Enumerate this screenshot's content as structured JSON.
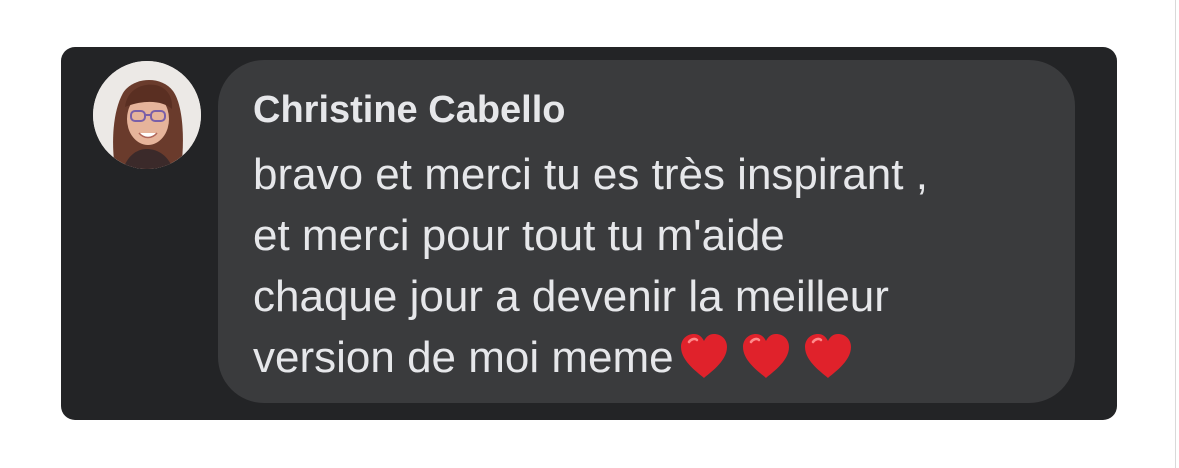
{
  "comment": {
    "author": "Christine Cabello",
    "message_lines": [
      "bravo et merci tu es très inspirant ,",
      "et merci pour tout tu m'aide",
      "chaque jour a devenir la meilleur",
      "version de moi meme"
    ],
    "emoji": [
      "red-heart",
      "red-heart",
      "red-heart"
    ]
  },
  "colors": {
    "card_background": "#232426",
    "bubble_background": "#3a3b3d",
    "text": "#e6e7ea",
    "heart": "#e0222b"
  }
}
